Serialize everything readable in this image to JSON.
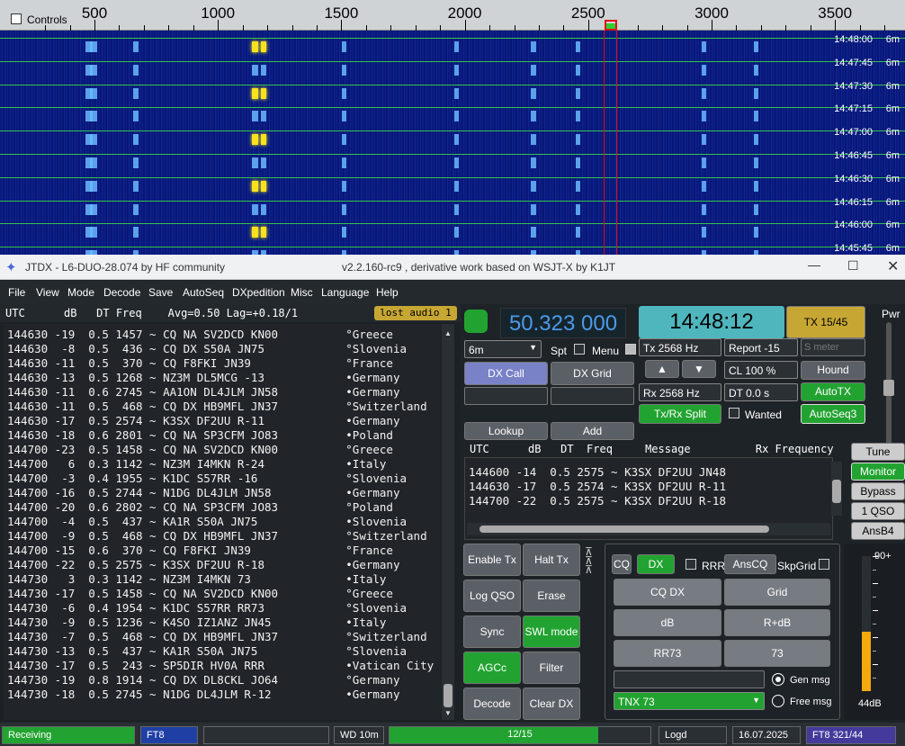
{
  "waterfall": {
    "controls_label": "Controls",
    "ticks": [
      "500",
      "1000",
      "1500",
      "2000",
      "2500",
      "3000",
      "3500"
    ],
    "timestamps": [
      "14:48:00",
      "14:47:45",
      "14:47:30",
      "14:47:15",
      "14:47:00",
      "14:46:45",
      "14:46:30",
      "14:46:15",
      "14:46:00",
      "14:45:45"
    ],
    "band": "6m"
  },
  "window": {
    "title": "JTDX - L6-DUO-28.074  by HF community",
    "subtitle": "v2.2.160-rc9 , derivative work based on WSJT-X by K1JT"
  },
  "menu": [
    "File",
    "View",
    "Mode",
    "Decode",
    "Save",
    "AutoSeq",
    "DXpedition",
    "Misc",
    "Language",
    "Help"
  ],
  "left": {
    "header": "UTC      dB   DT Freq    Avg=0.50 Lag=+0.18/1",
    "lost_audio": "lost audio 1",
    "rows": [
      "144630 -19  0.5 1457 ~ CQ NA SV2DCD KN00          °Greece",
      "144630  -8  0.5  436 ~ CQ DX S50A JN75            °Slovenia",
      "144630 -11  0.5  370 ~ CQ F8FKI JN39              °France",
      "144630 -13  0.5 1268 ~ NZ3M DL5MCG -13            •Germany",
      "144630 -11  0.6 2745 ~ AA1ON DL4JLM JN58          •Germany",
      "144630 -11  0.5  468 ~ CQ DX HB9MFL JN37          °Switzerland",
      "144630 -17  0.5 2574 ~ K3SX DF2UU R-11            •Germany",
      "144630 -18  0.6 2801 ~ CQ NA SP3CFM JO83          •Poland",
      "144700 -23  0.5 1458 ~ CQ NA SV2DCD KN00          °Greece",
      "144700   6  0.3 1142 ~ NZ3M I4MKN R-24            •Italy",
      "144700  -3  0.4 1955 ~ K1DC S57RR -16             °Slovenia",
      "144700 -16  0.5 2744 ~ N1DG DL4JLM JN58           •Germany",
      "144700 -20  0.6 2802 ~ CQ NA SP3CFM JO83          °Poland",
      "144700  -4  0.5  437 ~ KA1R S50A JN75             •Slovenia",
      "144700  -9  0.5  468 ~ CQ DX HB9MFL JN37          °Switzerland",
      "144700 -15  0.6  370 ~ CQ F8FKI JN39              °France",
      "144700 -22  0.5 2575 ~ K3SX DF2UU R-18            •Germany",
      "144730   3  0.3 1142 ~ NZ3M I4MKN 73              •Italy",
      "144730 -17  0.5 1458 ~ CQ NA SV2DCD KN00          °Greece",
      "144730  -6  0.4 1954 ~ K1DC S57RR RR73            °Slovenia",
      "144730  -9  0.5 1236 ~ K4SO IZ1ANZ JN45           •Italy",
      "144730  -7  0.5  468 ~ CQ DX HB9MFL JN37          °Switzerland",
      "144730 -13  0.5  437 ~ KA1R S50A JN75             °Slovenia",
      "144730 -17  0.5  243 ~ SP5DIR HV0A RRR            •Vatican City",
      "144730 -19  0.8 1914 ~ CQ DX DL8CKL JO64          °Germany",
      "144730 -18  0.5 2745 ~ N1DG DL4JLM R-12           •Germany"
    ]
  },
  "right": {
    "freq": "50.323 000",
    "clock": "14:48:12",
    "tx_period": "TX 15/45",
    "pwr_label": "Pwr",
    "band_select": "6m",
    "spt": "Spt",
    "menu_lbl": "Menu",
    "tx_hz": "Tx  2568  Hz",
    "rx_hz": "Rx  2568  Hz",
    "report": "Report -15",
    "smeter": "S meter",
    "cl": "CL  100 %",
    "dt": "DT 0.0 s",
    "dx_call": "DX Call",
    "dx_grid": "DX Grid",
    "hound": "Hound",
    "autotx": "AutoTX",
    "split": "Tx/Rx Split",
    "wanted": "Wanted",
    "autoseq": "AutoSeq3",
    "lookup": "Lookup",
    "add": "Add",
    "rx_header": "UTC      dB   DT  Freq     Message          Rx Frequency",
    "rx_rows": [
      "144600 -14  0.5 2575 ~ K3SX DF2UU JN48",
      "144630 -17  0.5 2574 ~ K3SX DF2UU R-11",
      "144700 -22  0.5 2575 ~ K3SX DF2UU R-18"
    ],
    "side": [
      "Tune",
      "Monitor",
      "Bypass",
      "1 QSO",
      "AnsB4"
    ],
    "left_btns": [
      "Enable Tx",
      "Halt Tx",
      "Log QSO",
      "Erase",
      "Sync",
      "SWL mode",
      "AGCc",
      "Filter",
      "Decode",
      "Clear DX"
    ],
    "cq": "CQ",
    "dx": "DX",
    "rrr": "RRR",
    "anscq": "AnsCQ",
    "skpgrid": "SkpGrid",
    "msgs": [
      "CQ DX",
      "Grid",
      "dB",
      "R+dB",
      "RR73",
      "73"
    ],
    "gen_msg": "Gen msg",
    "free_msg": "Free msg",
    "tnx": "TNX 73",
    "meter_top": "90+",
    "meter_db": "44dB",
    "meter_ticks": [
      "80",
      "60",
      "40",
      "20",
      "0"
    ],
    "meter_level": 0.44
  },
  "status": {
    "receiving": "Receiving",
    "mode": "FT8",
    "wd": "WD 10m",
    "progress": "12/15",
    "progress_frac": 0.8,
    "logd": "Logd",
    "date": "16.07.2025",
    "ft8": "FT8  321/44"
  }
}
